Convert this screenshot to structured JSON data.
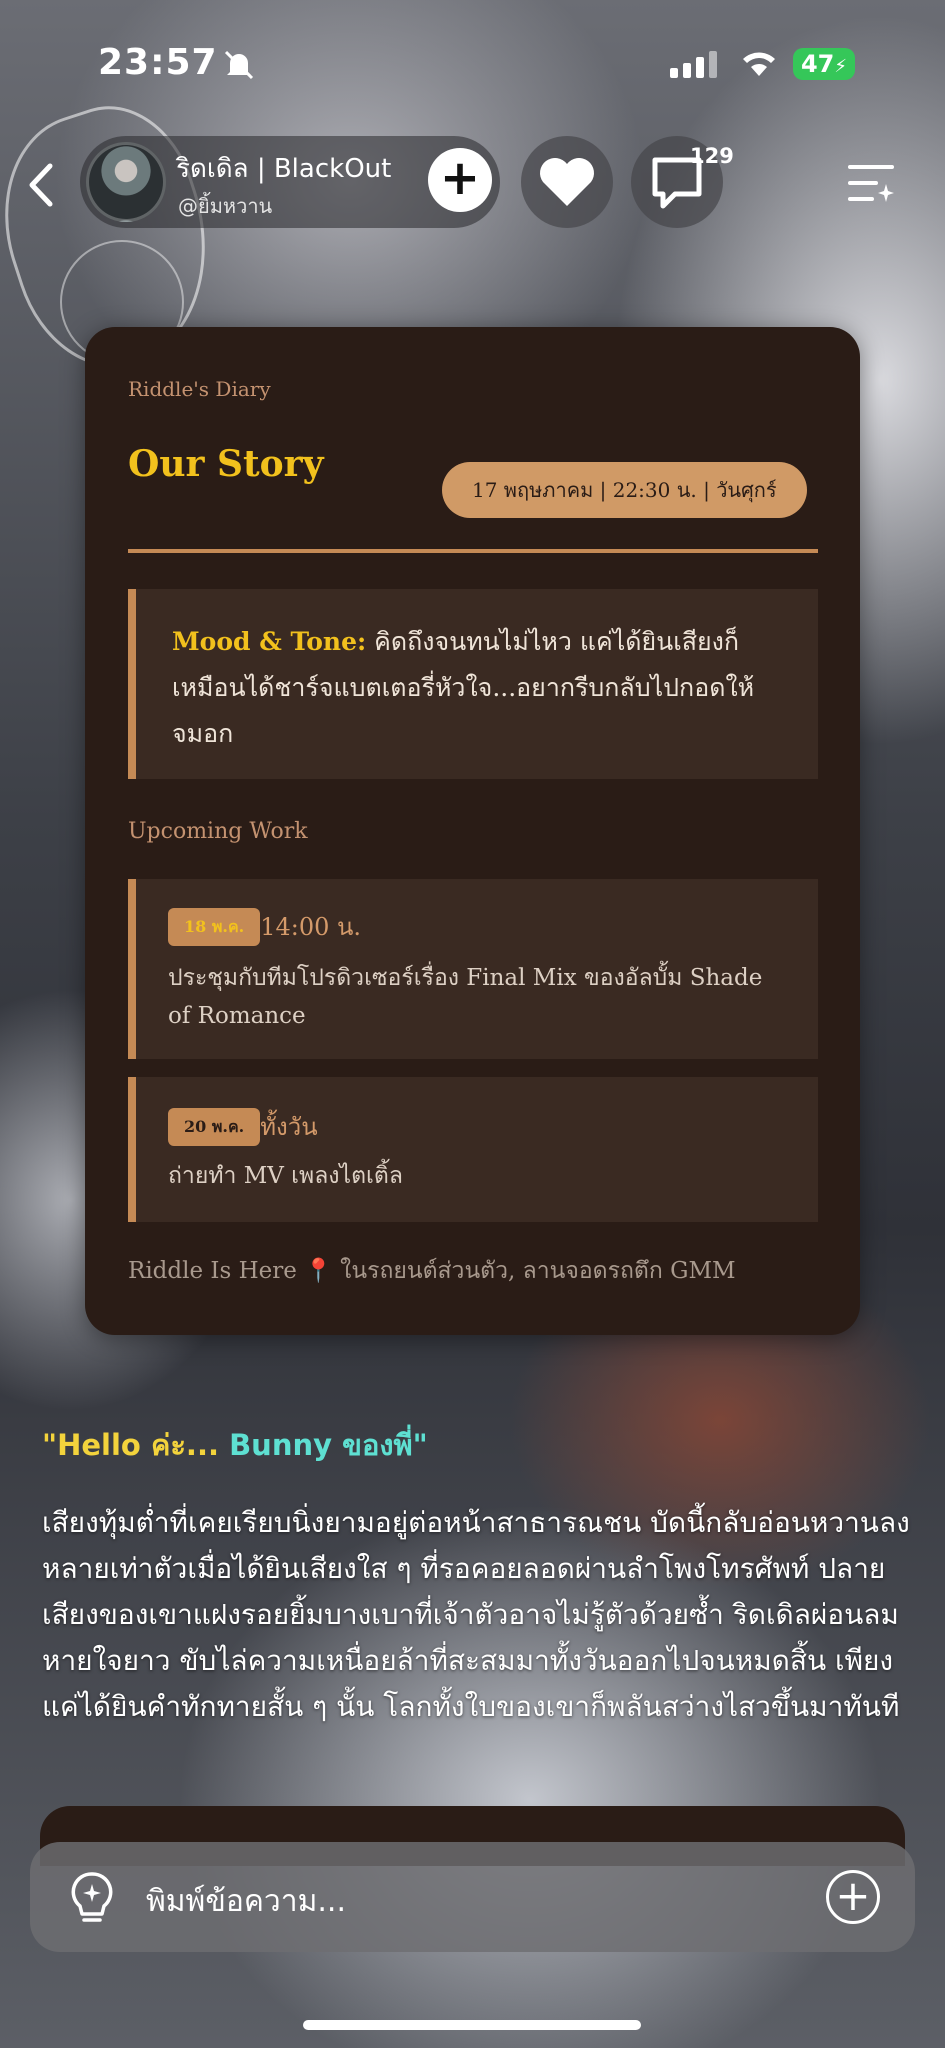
{
  "status_bar": {
    "time": "23:57",
    "battery": "47"
  },
  "header": {
    "profile_name": "ริดเดิล | BlackOut",
    "profile_handle": "@ยิ้มหวาน",
    "add_label": "+",
    "comment_count": "129"
  },
  "diary": {
    "label": "Riddle's Diary",
    "title": "Our Story",
    "date": "17 พฤษภาคม | 22:30 น. | วันศุกร์",
    "mood_label": "Mood & Tone:",
    "mood_text": " คิดถึงจนทนไม่ไหว แค่ได้ยินเสียงก็เหมือนได้ชาร์จแบตเตอรี่หัวใจ...อยากรีบกลับไปกอดให้จมอก",
    "upcoming_label": "Upcoming Work",
    "work": [
      {
        "date": "18 พ.ค.",
        "time": "14:00 น.",
        "desc": "ประชุมกับทีมโปรดิวเซอร์เรื่อง Final Mix ของอัลบั้ม Shade of Romance"
      },
      {
        "date": "20 พ.ค.",
        "time": "ทั้งวัน",
        "desc": "ถ่ายทำ MV เพลงไตเติ้ล"
      }
    ],
    "location_label": "Riddle Is Here",
    "location_pin": "📍",
    "location_text": " ในรถยนต์ส่วนตัว, ลานจอดรถตึก GMM"
  },
  "message": {
    "greeting_part1": "\"Hello ค่ะ... ",
    "greeting_part2": "Bunny ของพี่\"",
    "paragraph": "เสียงทุ้มต่ำที่เคยเรียบนิ่งยามอยู่ต่อหน้าสาธารณชน บัดนี้กลับอ่อนหวานลงหลายเท่าตัวเมื่อได้ยินเสียงใส ๆ ที่รอคอยลอดผ่านลำโพงโทรศัพท์ ปลายเสียงของเขาแฝงรอยยิ้มบางเบาที่เจ้าตัวอาจไม่รู้ตัวด้วยซ้ำ ริดเดิลผ่อนลมหายใจยาว ขับไล่ความเหนื่อยล้าที่สะสมมาทั้งวันออกไปจนหมดสิ้น เพียงแค่ได้ยินคำทักทายสั้น ๆ นั้น โลกทั้งใบของเขาก็พลันสว่างไสวขึ้นมาทันที"
  },
  "input": {
    "placeholder": "พิมพ์ข้อความ..."
  },
  "colors": {
    "card_bg": "#2a1c16",
    "accent_gold": "#f2c11d",
    "accent_copper": "#c58a55",
    "greeting_cyan": "#5ee0d2"
  }
}
